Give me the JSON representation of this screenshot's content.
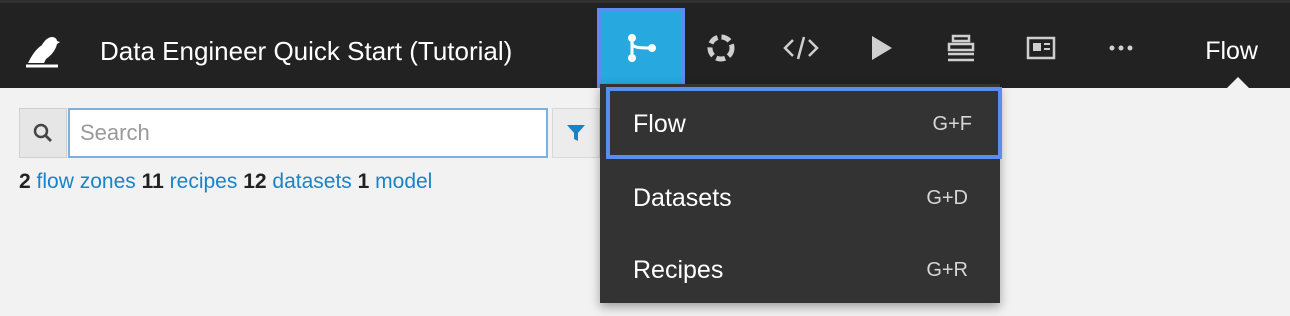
{
  "app": {
    "project_title": "Data Engineer Quick Start (Tutorial)",
    "current_section": "Flow"
  },
  "nav": {
    "icons": [
      "flow-icon",
      "circle-icon",
      "code-icon",
      "play-icon",
      "stack-icon",
      "dashboard-icon",
      "more-icon"
    ],
    "accent_color": "#27a8de",
    "focus_color": "#5b8cf0"
  },
  "search": {
    "placeholder": "Search"
  },
  "summary": {
    "zones_count": "2",
    "zones_label": "flow zones",
    "recipes_count": "11",
    "recipes_label": "recipes",
    "datasets_count": "12",
    "datasets_label": "datasets",
    "models_count": "1",
    "models_label": "model"
  },
  "dropdown": {
    "items": [
      {
        "label": "Flow",
        "shortcut": "G+F"
      },
      {
        "label": "Datasets",
        "shortcut": "G+D"
      },
      {
        "label": "Recipes",
        "shortcut": "G+R"
      }
    ]
  }
}
